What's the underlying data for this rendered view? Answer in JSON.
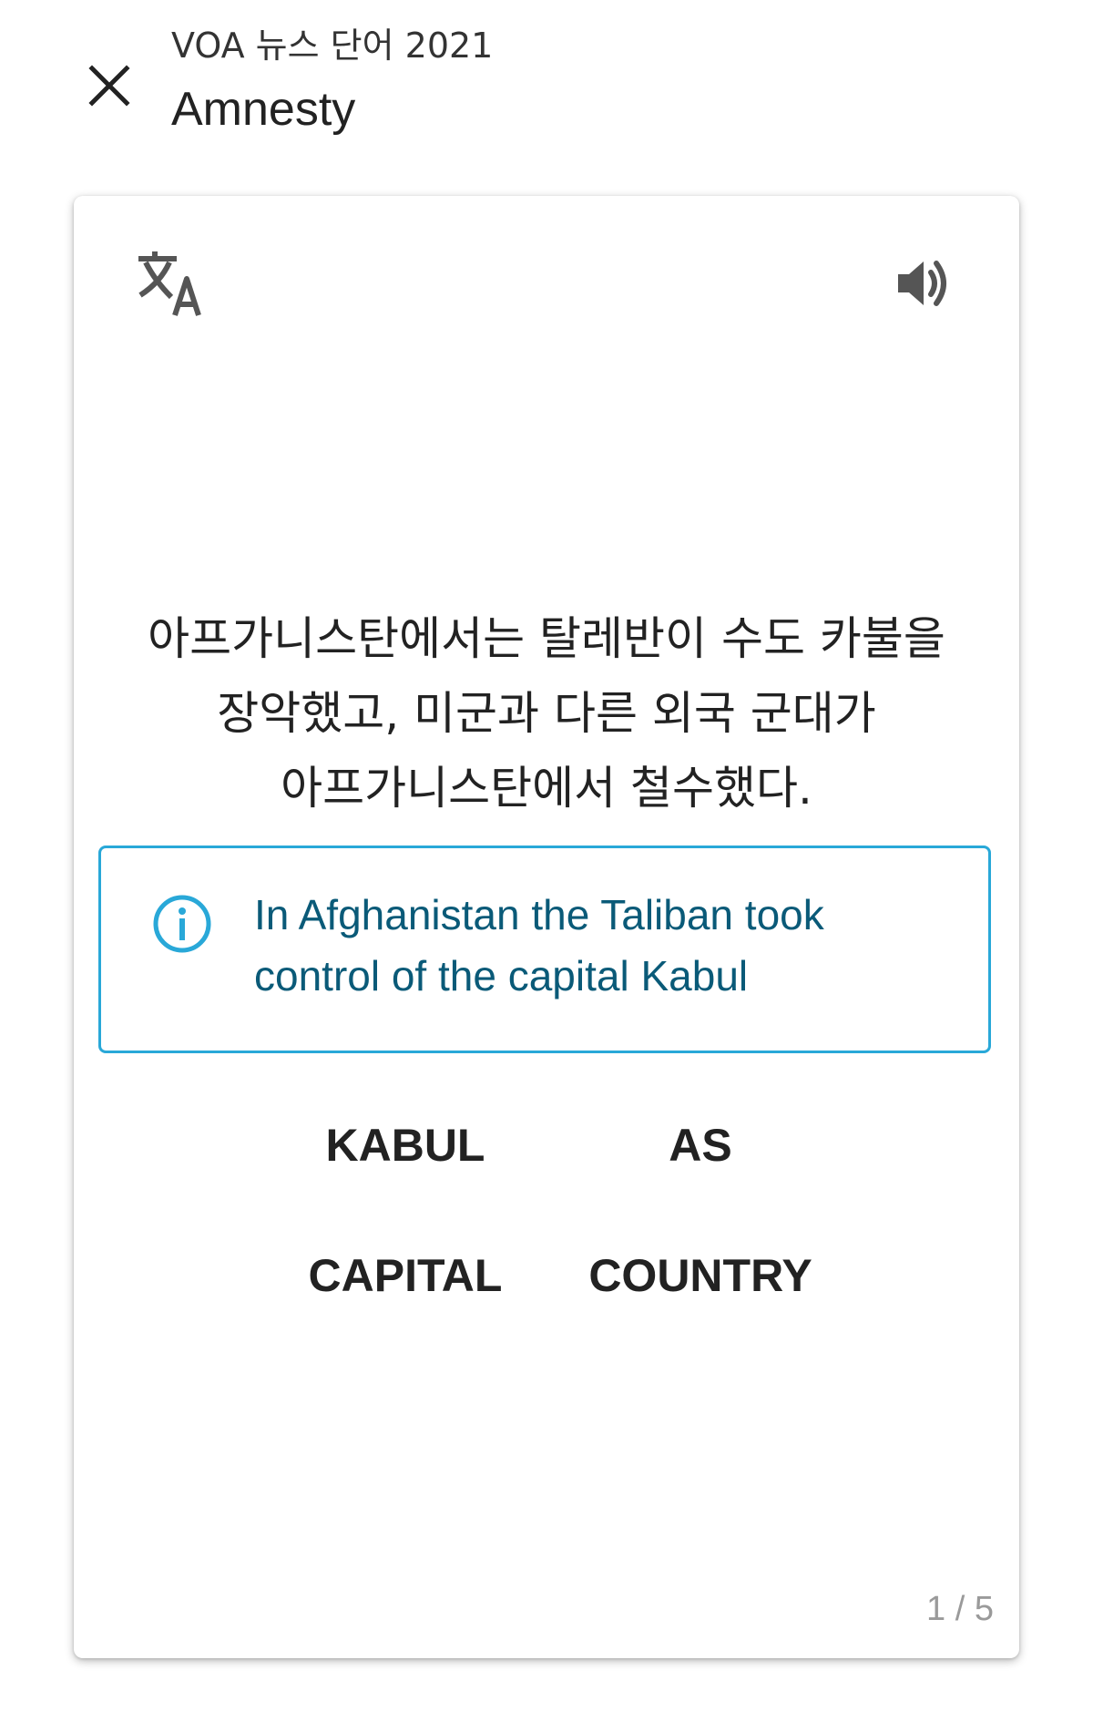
{
  "header": {
    "subtitle": "VOA 뉴스 단어 2021",
    "title": "Amnesty",
    "close_icon": "close-icon"
  },
  "card": {
    "translate_icon": "translate-icon",
    "speaker_icon": "speaker-icon",
    "korean_lines": [
      "아프가니스탄에서는 탈레반이 수도 카불을",
      "장악했고, 미군과 다른 외국 군대가",
      "아프가니스탄에서 철수했다."
    ],
    "hint": {
      "icon": "info-icon",
      "lines": [
        "In Afghanistan the Taliban took",
        "control of the capital Kabul"
      ],
      "color": "#29a8d8"
    },
    "choices": [
      "KABUL",
      "AS",
      "CAPITAL",
      "COUNTRY"
    ],
    "counter": "1 / 5"
  }
}
